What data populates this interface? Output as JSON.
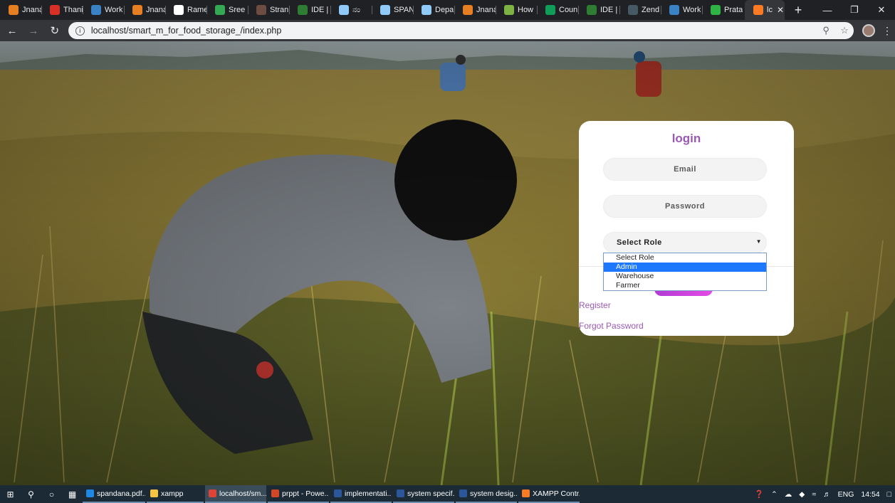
{
  "browser": {
    "tabs": [
      {
        "title": "Jnana",
        "icon": "sun-icon",
        "color": "#e67e22"
      },
      {
        "title": "Thani",
        "icon": "gmail-icon",
        "color": "#d93025"
      },
      {
        "title": "Work",
        "icon": "wave-icon",
        "color": "#3b82c4"
      },
      {
        "title": "Jnana",
        "icon": "sun-icon",
        "color": "#e67e22"
      },
      {
        "title": "Rame",
        "icon": "wikipedia-icon",
        "color": "#ffffff"
      },
      {
        "title": "Sree",
        "icon": "image-icon",
        "color": "#34a853"
      },
      {
        "title": "Stran",
        "icon": "cc-icon",
        "color": "#6d4c41"
      },
      {
        "title": "IDE |",
        "icon": "ide-icon",
        "color": "#2e7d32"
      },
      {
        "title": "ನಂ",
        "icon": "doc-icon",
        "color": "#90caf9"
      },
      {
        "title": "SPAN",
        "icon": "doc-icon",
        "color": "#90caf9"
      },
      {
        "title": "Depa",
        "icon": "doc-icon",
        "color": "#90caf9"
      },
      {
        "title": "Jnana",
        "icon": "sun-icon",
        "color": "#e67e22"
      },
      {
        "title": "How",
        "icon": "globe-icon",
        "color": "#7cb342"
      },
      {
        "title": "Coun",
        "icon": "dc-icon",
        "color": "#0f9d58"
      },
      {
        "title": "IDE |",
        "icon": "ide-icon",
        "color": "#2e7d32"
      },
      {
        "title": "Zend",
        "icon": "zend-icon",
        "color": "#455a64"
      },
      {
        "title": "Work",
        "icon": "wave-icon",
        "color": "#3b82c4"
      },
      {
        "title": "Prata",
        "icon": "h-icon",
        "color": "#2fb344"
      }
    ],
    "active_tab": {
      "title": "lc",
      "icon": "xampp-icon",
      "color": "#fb7a24"
    },
    "url": "localhost/smart_m_for_food_storage_/index.php"
  },
  "login": {
    "title": "login",
    "email_placeholder": "Email",
    "password_placeholder": "Password",
    "role_selected": "Select Role",
    "role_options": [
      {
        "label": "Select Role",
        "selected": false
      },
      {
        "label": "Admin",
        "selected": true
      },
      {
        "label": "Warehouse",
        "selected": false
      },
      {
        "label": "Farmer",
        "selected": false
      }
    ],
    "register_link": "Register",
    "forgot_link": "Forgot Password",
    "accent_color": "#9b59b6"
  },
  "taskbar": {
    "apps": [
      {
        "label": "spandana.pdf...",
        "icon": "edge-icon",
        "color": "#1e88e5"
      },
      {
        "label": "xampp",
        "icon": "folder-icon",
        "color": "#f6c343"
      },
      {
        "label": "localhost/sm...",
        "icon": "chrome-icon",
        "color": "#db4437"
      },
      {
        "label": "prppt - Powe...",
        "icon": "powerpoint-icon",
        "color": "#d24726"
      },
      {
        "label": "implementati...",
        "icon": "word-icon",
        "color": "#2b579a"
      },
      {
        "label": "system specif...",
        "icon": "word-icon",
        "color": "#2b579a"
      },
      {
        "label": "system desig...",
        "icon": "word-icon",
        "color": "#2b579a"
      },
      {
        "label": "XAMPP Contr...",
        "icon": "xampp-icon",
        "color": "#fb7a24"
      }
    ],
    "language": "ENG",
    "time": "14:54"
  }
}
